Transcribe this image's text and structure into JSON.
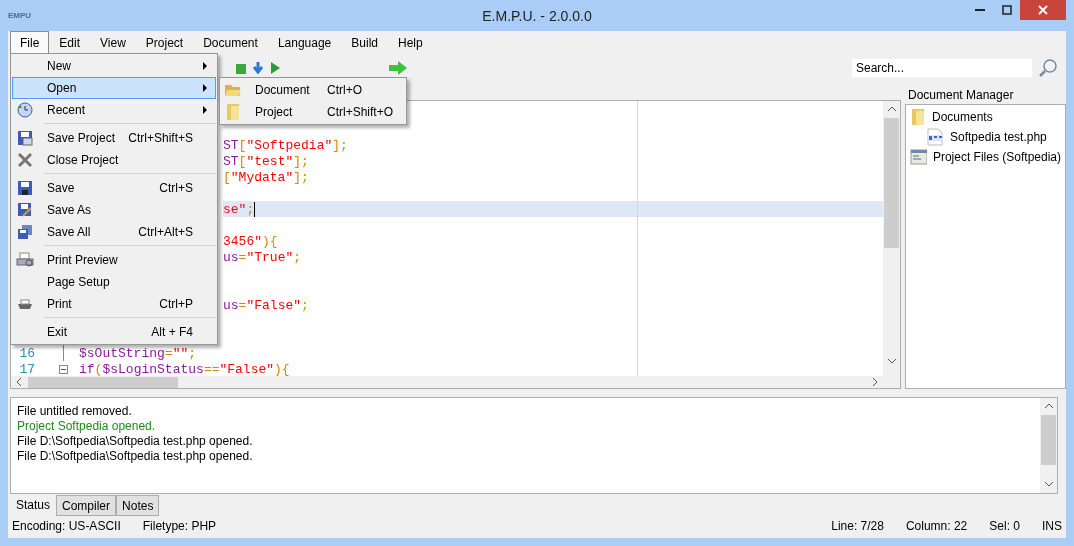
{
  "window": {
    "logo": "EMPU",
    "title": "E.M.P.U. - 2.0.0.0"
  },
  "menubar": [
    {
      "label": "File",
      "selected": true
    },
    {
      "label": "Edit",
      "selected": false
    },
    {
      "label": "View",
      "selected": false
    },
    {
      "label": "Project",
      "selected": false
    },
    {
      "label": "Document",
      "selected": false
    },
    {
      "label": "Language",
      "selected": false
    },
    {
      "label": "Build",
      "selected": false
    },
    {
      "label": "Help",
      "selected": false
    }
  ],
  "search": {
    "placeholder": "Search..."
  },
  "file_menu": [
    {
      "kind": "item",
      "label": "New",
      "submenu": true,
      "selected": false
    },
    {
      "kind": "item",
      "label": "Open",
      "submenu": true,
      "selected": true
    },
    {
      "kind": "item",
      "label": "Recent",
      "submenu": true,
      "selected": false
    },
    {
      "kind": "separator"
    },
    {
      "kind": "item",
      "label": "Save Project",
      "shortcut": "Ctrl+Shift+S",
      "submenu": false,
      "selected": false
    },
    {
      "kind": "item",
      "label": "Close Project",
      "submenu": false,
      "selected": false
    },
    {
      "kind": "separator"
    },
    {
      "kind": "item",
      "label": "Save",
      "shortcut": "Ctrl+S",
      "submenu": false,
      "selected": false
    },
    {
      "kind": "item",
      "label": "Save As",
      "submenu": false,
      "selected": false
    },
    {
      "kind": "item",
      "label": "Save All",
      "shortcut": "Ctrl+Alt+S",
      "submenu": false,
      "selected": false
    },
    {
      "kind": "separator"
    },
    {
      "kind": "item",
      "label": "Print Preview",
      "submenu": false,
      "selected": false
    },
    {
      "kind": "item",
      "label": "Page Setup",
      "submenu": false,
      "selected": false
    },
    {
      "kind": "item",
      "label": "Print",
      "shortcut": "Ctrl+P",
      "submenu": false,
      "selected": false
    },
    {
      "kind": "separator"
    },
    {
      "kind": "item",
      "label": "Exit",
      "shortcut": "Alt + F4",
      "submenu": false,
      "selected": false
    }
  ],
  "open_submenu": [
    {
      "label": "Document",
      "shortcut": "Ctrl+O"
    },
    {
      "label": "Project",
      "shortcut": "Ctrl+Shift+O"
    }
  ],
  "editor": {
    "lines": [
      {
        "kind": "covered"
      },
      {
        "kind": "covered"
      },
      {
        "kind": "covered",
        "current": false,
        "tokens": [
          {
            "kind": "var",
            "text": "ST"
          },
          {
            "kind": "op",
            "text": "["
          },
          {
            "kind": "str",
            "text": "\"Softpedia\""
          },
          {
            "kind": "op",
            "text": "];"
          }
        ]
      },
      {
        "kind": "covered",
        "current": false,
        "tokens": [
          {
            "kind": "var",
            "text": "ST"
          },
          {
            "kind": "op",
            "text": "["
          },
          {
            "kind": "str",
            "text": "\"test\""
          },
          {
            "kind": "op",
            "text": "];"
          }
        ]
      },
      {
        "kind": "covered",
        "current": false,
        "tokens": [
          {
            "kind": "op",
            "text": "["
          },
          {
            "kind": "str",
            "text": "\"Mydata\""
          },
          {
            "kind": "op",
            "text": "];"
          }
        ]
      },
      {
        "kind": "covered"
      },
      {
        "kind": "covered",
        "current": true,
        "tokens": [
          {
            "kind": "str",
            "text": "se\""
          },
          {
            "kind": "op",
            "text": ";"
          }
        ]
      },
      {
        "kind": "covered"
      },
      {
        "kind": "covered",
        "current": false,
        "tokens": [
          {
            "kind": "str",
            "text": "3456\""
          },
          {
            "kind": "op",
            "text": "){"
          }
        ]
      },
      {
        "kind": "covered",
        "current": false,
        "tokens": [
          {
            "kind": "var",
            "text": "us"
          },
          {
            "kind": "op",
            "text": "="
          },
          {
            "kind": "str",
            "text": "\"True\""
          },
          {
            "kind": "op",
            "text": ";"
          }
        ]
      },
      {
        "kind": "covered"
      },
      {
        "kind": "covered"
      },
      {
        "kind": "covered",
        "current": false,
        "tokens": [
          {
            "kind": "var",
            "text": "us"
          },
          {
            "kind": "op",
            "text": "="
          },
          {
            "kind": "str",
            "text": "\"False\""
          },
          {
            "kind": "op",
            "text": ";"
          }
        ]
      },
      {
        "kind": "covered"
      },
      {
        "kind": "covered"
      },
      {
        "kind": "full",
        "number": "16",
        "fold_start": false,
        "current": false,
        "tokens": [
          {
            "kind": "var",
            "text": "$sOutString"
          },
          {
            "kind": "op",
            "text": "="
          },
          {
            "kind": "str",
            "text": "\"\""
          },
          {
            "kind": "op",
            "text": ";"
          }
        ]
      },
      {
        "kind": "full",
        "number": "17",
        "fold_start": true,
        "current": false,
        "tokens": [
          {
            "kind": "var",
            "text": "if"
          },
          {
            "kind": "op",
            "text": "("
          },
          {
            "kind": "var",
            "text": "$sLoginStatus"
          },
          {
            "kind": "op",
            "text": "=="
          },
          {
            "kind": "str",
            "text": "\"False\""
          },
          {
            "kind": "op",
            "text": "){"
          }
        ]
      }
    ]
  },
  "document_manager": {
    "title": "Document Manager",
    "tree": [
      {
        "label": "Documents",
        "kind": "folder",
        "children": [
          {
            "label": "Softpedia test.php",
            "kind": "php"
          }
        ]
      },
      {
        "label": "Project Files (Softpedia)",
        "kind": "project"
      }
    ]
  },
  "output": [
    {
      "kind": "info",
      "text": "File untitled removed."
    },
    {
      "kind": "success",
      "text": "Project Softpedia opened."
    },
    {
      "kind": "info",
      "text": "File D:\\Softpedia\\Softpedia test.php opened."
    },
    {
      "kind": "info",
      "text": "File D:\\Softpedia\\Softpedia test.php opened."
    }
  ],
  "bottom_tabs": [
    {
      "label": "Status",
      "selected": true
    },
    {
      "label": "Compiler",
      "selected": false
    },
    {
      "label": "Notes",
      "selected": false
    }
  ],
  "status_bar": {
    "left": [
      "Encoding: US-ASCII",
      "Filetype: PHP"
    ],
    "right": [
      "Line: 7/28",
      "Column: 22",
      "Sel: 0",
      "INS"
    ]
  }
}
